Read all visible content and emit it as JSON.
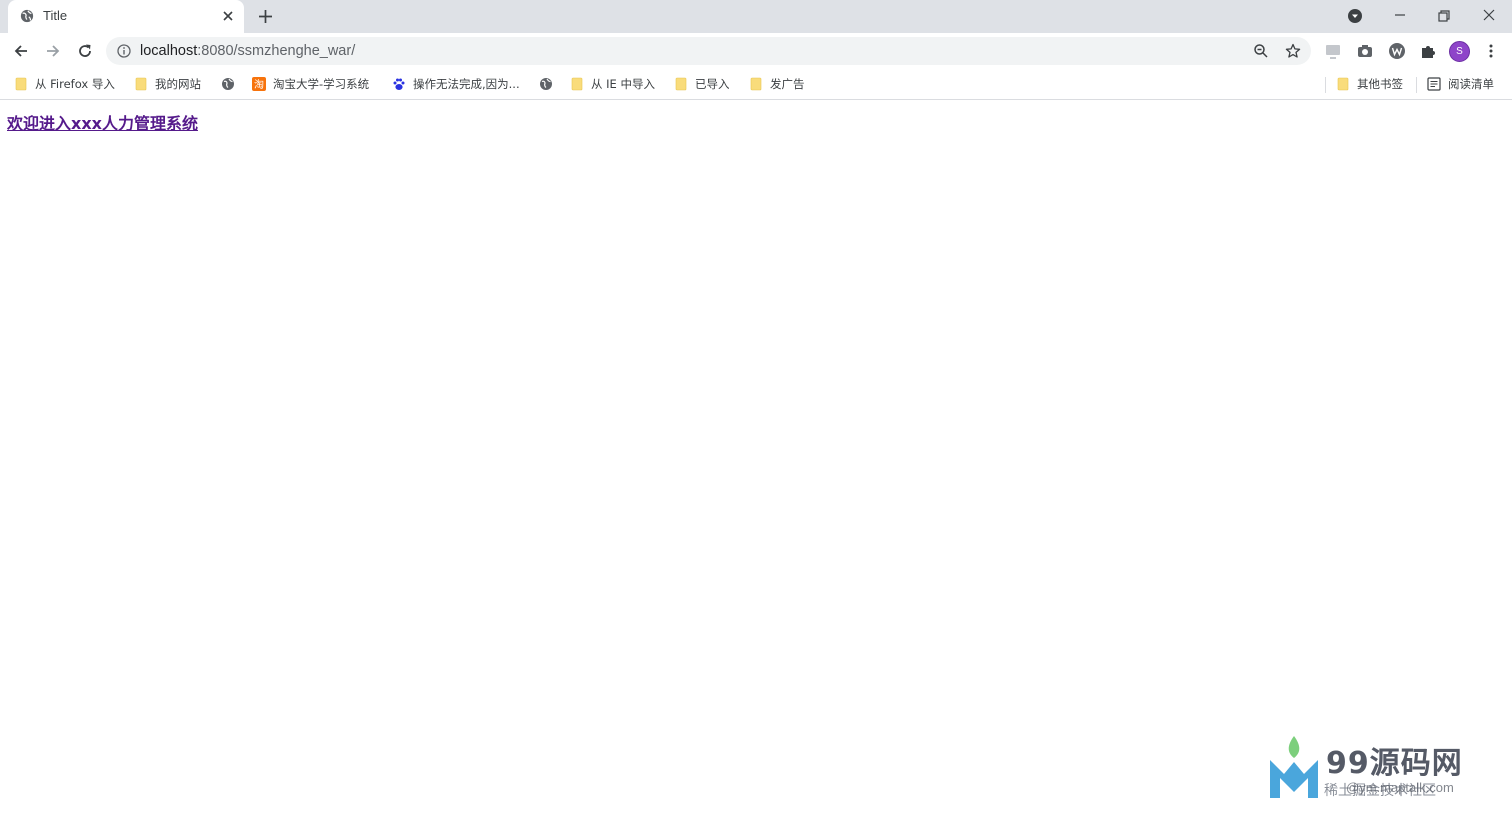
{
  "browser": {
    "tab": {
      "title": "Title"
    },
    "url": {
      "host": "localhost",
      "rest": ":8080/ssmzhenghe_war/"
    },
    "profile_initial": "S",
    "colors": {
      "tabstrip": "#dee1e6",
      "profile": "#8e44c9",
      "link_visited": "#551a8b"
    }
  },
  "bookmarks": {
    "items": [
      {
        "label": "从 Firefox 导入",
        "icon": "folder-icon"
      },
      {
        "label": "我的网站",
        "icon": "folder-icon"
      },
      {
        "label": "",
        "icon": "globe-icon"
      },
      {
        "label": "淘宝大学-学习系统",
        "icon": "taobao-icon"
      },
      {
        "label": "操作无法完成,因为...",
        "icon": "baidu-icon"
      },
      {
        "label": "",
        "icon": "globe-icon"
      },
      {
        "label": "从 IE 中导入",
        "icon": "folder-icon"
      },
      {
        "label": "已导入",
        "icon": "folder-icon"
      },
      {
        "label": "发广告",
        "icon": "folder-icon"
      }
    ],
    "other": "其他书签",
    "reading_list": "阅读清单"
  },
  "page": {
    "link_text": "欢迎进入xxx人力管理系统"
  },
  "watermark": {
    "brand": "99源码网",
    "sub1": "稀土掘金技术社区",
    "sub2": "@ym.maptalk.com"
  }
}
